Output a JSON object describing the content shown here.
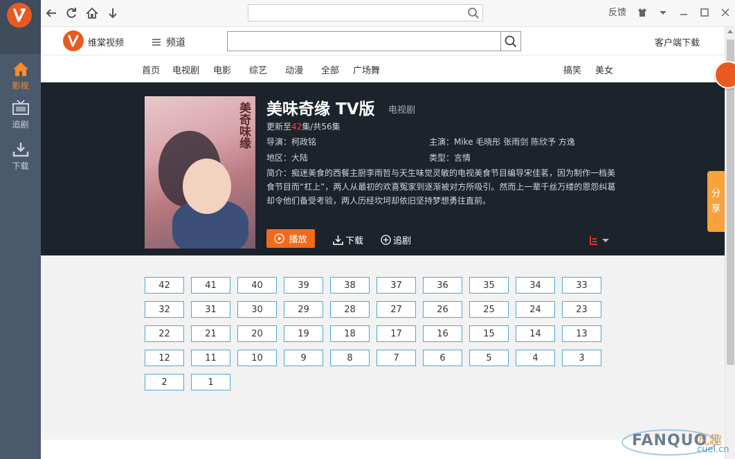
{
  "sidebar": {
    "items": [
      {
        "label": "影视",
        "icon": "home-icon",
        "active": true
      },
      {
        "label": "追剧",
        "icon": "tv-icon",
        "active": false
      },
      {
        "label": "下载",
        "icon": "download-icon",
        "active": false
      }
    ]
  },
  "titlebar": {
    "search_value": "",
    "feedback": "反馈",
    "icons": [
      "back-icon",
      "refresh-icon",
      "home-icon",
      "down-arrow-icon",
      "search-icon",
      "skin-icon",
      "menu-dropdown-icon",
      "minimize-icon",
      "maximize-icon",
      "close-icon"
    ]
  },
  "site_header": {
    "site_name": "维棠视频",
    "channel_label": "频道",
    "search_value": "",
    "client_download": "客户端下载"
  },
  "categories": {
    "main": [
      "首页",
      "电视剧",
      "电影",
      "综艺",
      "动漫",
      "全部",
      "广场舞"
    ],
    "right": [
      "搞笑",
      "美女"
    ]
  },
  "show": {
    "poster_title": "美奇味缘",
    "title": "美味奇缘  TV版",
    "genre_tag": "电视剧",
    "update_prefix": "更新至",
    "update_current": "42",
    "update_suffix": "集/共56集",
    "director": "导演：柯政铭",
    "cast": "主演：Mike 毛晓彤 张雨剑 陈欣予 方逸",
    "region": "地区：大陆",
    "type": "类型：言情",
    "synopsis": "简介：痴迷美食的西餐主厨李雨哲与天生味觉灵敏的电视美食节目编导宋佳茗，因为制作一档美食节目而“杠上”，两人从最初的欢喜冤家到逐渐被对方所吸引。然而上一辈千丝万缕的恩怨纠葛却令他们备受考验，两人历经坎坷却依旧坚持梦想勇往直前。",
    "play_label": "播放",
    "download_label": "下载",
    "follow_label": "追剧",
    "source_logo": "le-icon"
  },
  "share": {
    "line1": "分",
    "line2": "享"
  },
  "episodes": [
    "42",
    "41",
    "40",
    "39",
    "38",
    "37",
    "36",
    "35",
    "34",
    "33",
    "32",
    "31",
    "30",
    "29",
    "28",
    "27",
    "26",
    "25",
    "24",
    "23",
    "22",
    "21",
    "20",
    "19",
    "18",
    "17",
    "16",
    "15",
    "14",
    "13",
    "12",
    "11",
    "10",
    "9",
    "8",
    "7",
    "6",
    "5",
    "4",
    "3",
    "2",
    "1"
  ],
  "watermark": {
    "text": "FANQUO",
    "cn": "凡趣",
    "domain": "cuel.cn"
  },
  "colors": {
    "accent": "#f26a1b",
    "sidebar": "#4a5a6c",
    "active": "#ff8a2a",
    "episode_border": "#4aa8d8",
    "share": "#f7a23a"
  }
}
